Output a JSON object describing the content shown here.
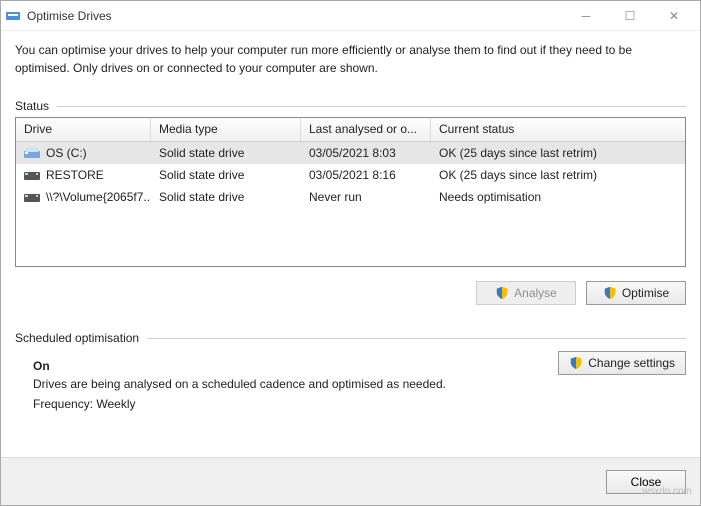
{
  "window": {
    "title": "Optimise Drives"
  },
  "intro": "You can optimise your drives to help your computer run more efficiently or analyse them to find out if they need to be optimised. Only drives on or connected to your computer are shown.",
  "status_label": "Status",
  "columns": {
    "drive": "Drive",
    "media": "Media type",
    "last": "Last analysed or o...",
    "status": "Current status"
  },
  "drives": [
    {
      "name": "OS (C:)",
      "media": "Solid state drive",
      "last": "03/05/2021 8:03",
      "status": "OK (25 days since last retrim)",
      "selected": true,
      "icon": "os"
    },
    {
      "name": "RESTORE",
      "media": "Solid state drive",
      "last": "03/05/2021 8:16",
      "status": "OK (25 days since last retrim)",
      "selected": false,
      "icon": "hdd"
    },
    {
      "name": "\\\\?\\Volume{2065f7...",
      "media": "Solid state drive",
      "last": "Never run",
      "status": "Needs optimisation",
      "selected": false,
      "icon": "hdd"
    }
  ],
  "buttons": {
    "analyse": "Analyse",
    "optimise": "Optimise",
    "change_settings": "Change settings",
    "close": "Close"
  },
  "schedule": {
    "label": "Scheduled optimisation",
    "state": "On",
    "text": "Drives are being analysed on a scheduled cadence and optimised as needed.",
    "freq": "Frequency: Weekly"
  },
  "watermark": "wsxdn.com"
}
